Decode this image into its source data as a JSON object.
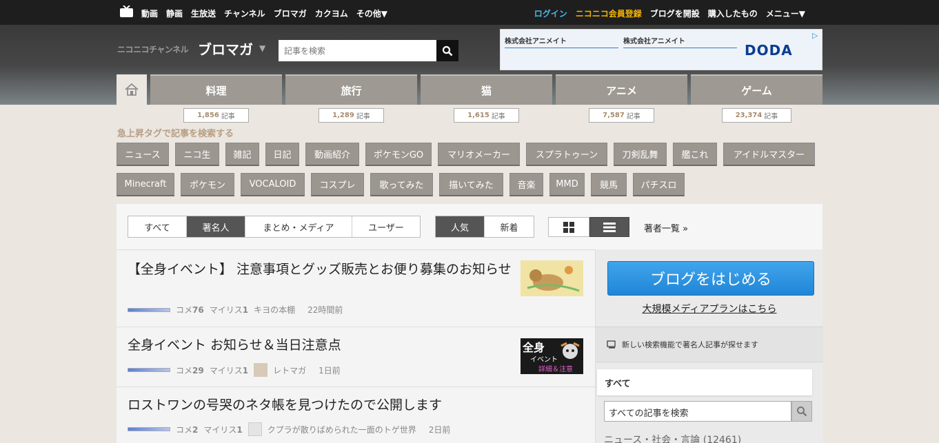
{
  "topbar": {
    "left_items": [
      "動画",
      "静画",
      "生放送",
      "チャンネル",
      "ブロマガ",
      "カクヨム",
      "その他▼"
    ],
    "right_items": {
      "login": "ログイン",
      "premium": "ニコニコ会員登録",
      "blog": "ブログを開設",
      "purchased": "購入したもの",
      "menu": "メニュー▼"
    }
  },
  "header": {
    "logo_sub": "ニコニコチャンネル",
    "logo_main": "ブロマガ",
    "logo_arrow": "▼",
    "search_placeholder": "記事を検索"
  },
  "ad": {
    "company1": "株式会社アニメイト",
    "company2": "株式会社アニメイト",
    "brand": "DODA",
    "choices": "▷"
  },
  "categories": [
    {
      "label": "料理",
      "count": "1,856",
      "unit": "記事"
    },
    {
      "label": "旅行",
      "count": "1,289",
      "unit": "記事"
    },
    {
      "label": "猫",
      "count": "1,615",
      "unit": "記事"
    },
    {
      "label": "アニメ",
      "count": "7,587",
      "unit": "記事"
    },
    {
      "label": "ゲーム",
      "count": "23,374",
      "unit": "記事"
    }
  ],
  "tags_heading": "急上昇タグで記事を検索する",
  "tags_row1": [
    "ニュース",
    "ニコ生",
    "雑記",
    "日記",
    "動画紹介",
    "ポケモンGO",
    "マリオメーカー",
    "スプラトゥーン",
    "刀剣乱舞",
    "艦これ",
    "アイドルマスター"
  ],
  "tags_row2": [
    "Minecraft",
    "ポケモン",
    "VOCALOID",
    "コスプレ",
    "歌ってみた",
    "描いてみた",
    "音楽",
    "MMD",
    "競馬",
    "パチスロ"
  ],
  "filters": {
    "type": [
      "すべて",
      "著名人",
      "まとめ・メディア",
      "ユーザー"
    ],
    "type_selected": "著名人",
    "sort": [
      "人気",
      "新着"
    ],
    "sort_selected": "人気",
    "authors_link": "著者一覧 »"
  },
  "articles": [
    {
      "title": "【全身イベント】 注意事項とグッズ販売とお便り募集のお知らせ",
      "comments_label": "コメ",
      "comments": "76",
      "mylist_label": "マイリス",
      "mylist": "1",
      "author": "キヨの本棚",
      "time": "22時間前"
    },
    {
      "title": "全身イベント お知らせ＆当日注意点",
      "comments_label": "コメ",
      "comments": "29",
      "mylist_label": "マイリス",
      "mylist": "1",
      "author": "レトマガ",
      "time": "1日前",
      "thumb_text1": "全身",
      "thumb_text2": "イベント",
      "thumb_text3": "詳細＆注意"
    },
    {
      "title": "ロストワンの号哭のネタ帳を見つけたので公開します",
      "comments_label": "コメ",
      "comments": "2",
      "mylist_label": "マイリス",
      "mylist": "1",
      "author": "クプラが散りばめられた一面のトゲ世界",
      "time": "2日前"
    }
  ],
  "sidebar": {
    "start_blog": "ブログをはじめる",
    "media_plan": "大規模メディアプランはこちら",
    "notice": "新しい検索機能で著名人記事が探せます",
    "all_tab": "すべて",
    "search_value": "すべての記事を検索",
    "category_line": "ニュース・社会・言論 (12461)"
  },
  "colors": {
    "accent_blue": "#2a8fd8",
    "premium": "#f4b400",
    "tag_bg": "#9c9690"
  }
}
